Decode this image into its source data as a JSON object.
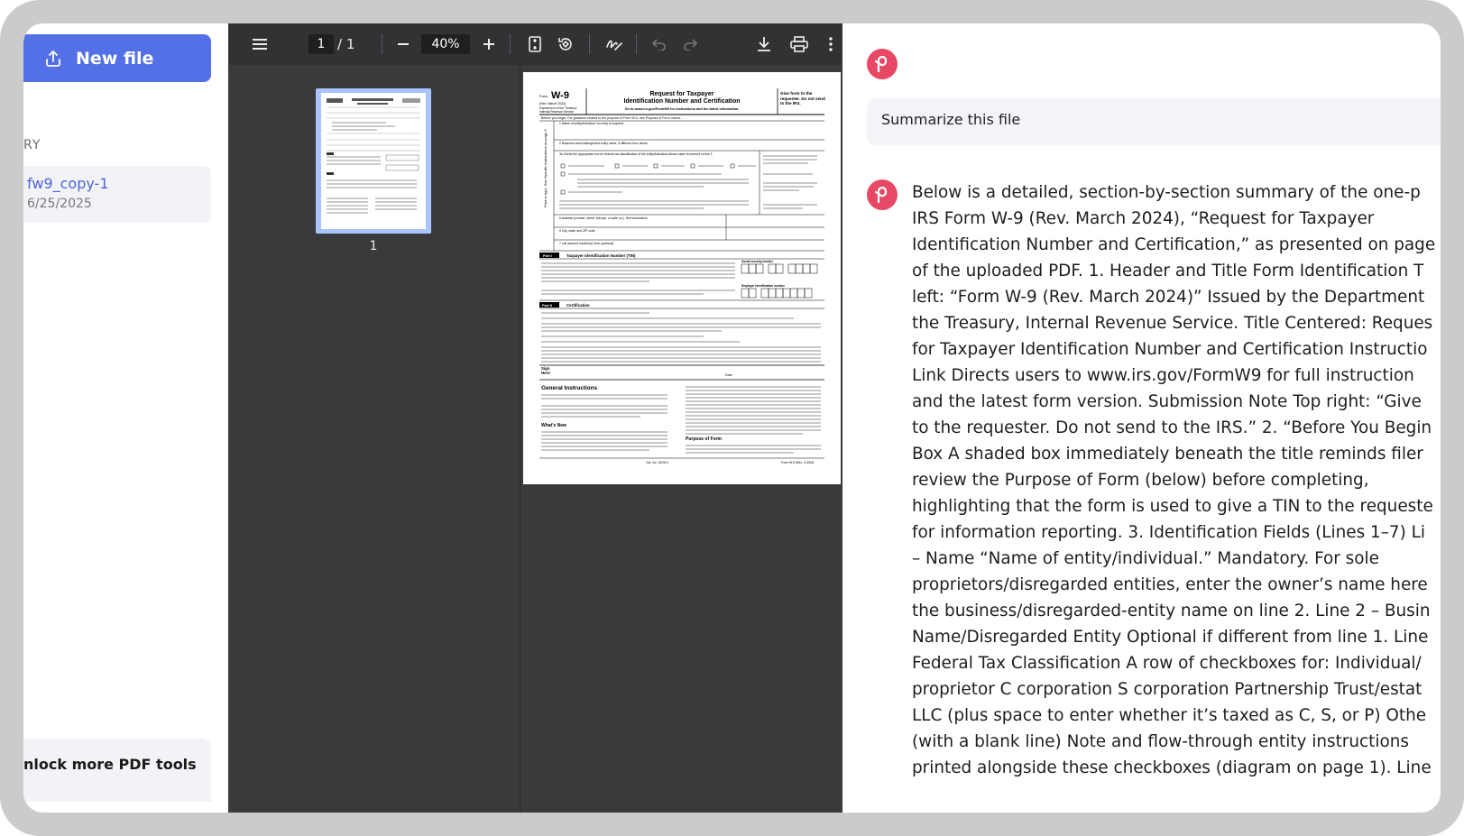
{
  "sidebar": {
    "new_file_label": "New file",
    "section_label": "RY",
    "files": [
      {
        "name": "fw9_copy-1",
        "date": "6/25/2025"
      }
    ],
    "unlock_label": "nlock more PDF tools"
  },
  "viewer": {
    "current_page": "1",
    "page_total": "/ 1",
    "zoom": "40%",
    "thumbnail_label": "1",
    "form": {
      "form_label": "Form",
      "form_number": "W-9",
      "rev": "(Rev. March 2024)",
      "dept": "Department of the Treasury",
      "irs": "Internal Revenue Service",
      "title_1": "Request for Taxpayer",
      "title_2": "Identification Number and Certification",
      "link_note": "Go to www.irs.gov/FormW9 for instructions and the latest information.",
      "give_form": "Give form to the requester. Do not send to the IRS.",
      "before_you_begin": "Before you begin. For guidance related to the purpose of Form W-9, see Purpose of Form, below.",
      "line1": "1 Name of entity/individual. An entry is required.",
      "line2": "2 Business name/disregarded entity name, if different from above.",
      "line3": "3a Check the appropriate box for federal tax classification of the entity/individual whose name is entered on line 1.",
      "line5": "5 Address (number, street, and apt. or suite no.). See instructions.",
      "line6": "6 City, state, and ZIP code",
      "line7": "7 List account number(s) here (optional)",
      "part1_tag": "Part I",
      "part1_title": "Taxpayer Identification Number (TIN)",
      "ssn_label": "Social security number",
      "ein_label": "Employer identification number",
      "part2_tag": "Part II",
      "part2_title": "Certification",
      "sign_here": "Sign Here",
      "date_label": "Date",
      "general_instructions": "General Instructions",
      "whats_new": "What's New",
      "purpose_of_form": "Purpose of Form",
      "cat_no": "Cat. No. 10231X",
      "footer_form": "Form W-9 (Rev. 3-2024)"
    }
  },
  "chat": {
    "user_message": "Summarize this file",
    "assistant_lines": [
      "Below is a detailed, section-by-section summary of the one-p",
      "IRS Form W-9 (Rev. March 2024), “Request for Taxpayer",
      "Identification Number and Certification,” as presented on page",
      "of the uploaded PDF. 1. Header and Title Form Identification T",
      "left: “Form W-9 (Rev. March 2024)” Issued by the Department",
      "the Treasury, Internal Revenue Service. Title Centered: Reques",
      "for Taxpayer Identification Number and Certification Instructio",
      "Link Directs users to www.irs.gov/FormW9 for full instruction",
      "and the latest form version. Submission Note Top right: “Give",
      "to the requester. Do not send to the IRS.” 2. “Before You Begin",
      "Box A shaded box immediately beneath the title reminds filer",
      "review the Purpose of Form (below) before completing,",
      "highlighting that the form is used to give a TIN to the requeste",
      "for information reporting. 3. Identification Fields (Lines 1–7) Li",
      "– Name “Name of entity/individual.” Mandatory. For sole",
      "proprietors/disregarded entities, enter the owner’s name here",
      "the business/disregarded-entity name on line 2. Line 2 – Busin",
      "Name/Disregarded Entity Optional if different from line 1. Line",
      "Federal Tax Classification A row of checkboxes for: Individual/",
      "proprietor C corporation S corporation Partnership Trust/estat",
      "LLC (plus space to enter whether it’s taxed as C, S, or P) Othe",
      "(with a blank line) Note and flow-through entity instructions",
      "printed alongside these checkboxes (diagram on page 1). Line"
    ]
  },
  "colors": {
    "accent": "#5470e6",
    "brand": "#e74866",
    "viewer_bg": "#3a3a3c",
    "toolbar_bg": "#323235"
  },
  "icons": {
    "new_file": "upload-icon",
    "sidebar_toggle": "menu-icon",
    "zoom_out": "minus-icon",
    "zoom_in": "plus-icon",
    "fit_page": "fit-page-icon",
    "rotate": "rotate-icon",
    "draw": "draw-icon",
    "undo": "undo-icon",
    "redo": "redo-icon",
    "download": "download-icon",
    "print": "print-icon",
    "more": "more-vertical-icon",
    "brand": "brand-logo-icon"
  }
}
